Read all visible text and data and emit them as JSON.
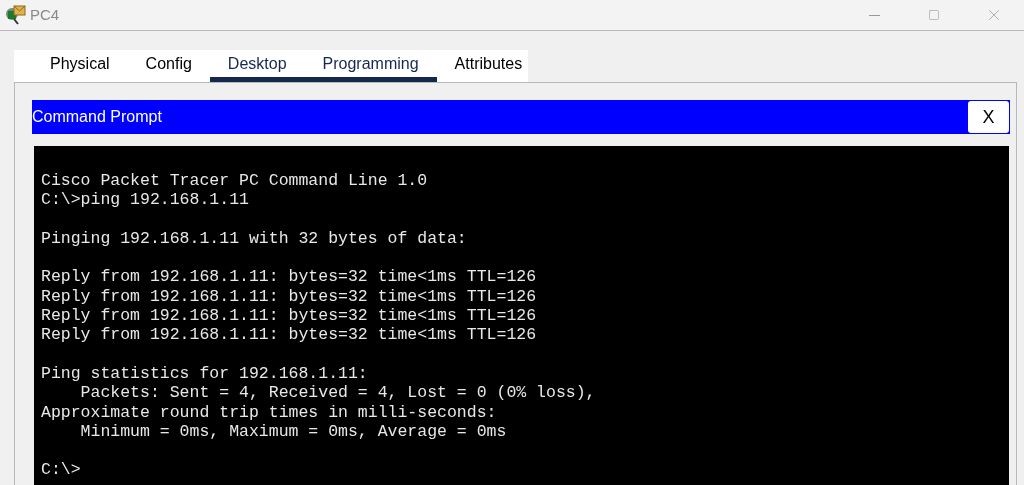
{
  "window": {
    "title": "PC4"
  },
  "tabs": [
    {
      "label": "Physical",
      "selected": false
    },
    {
      "label": "Config",
      "selected": false
    },
    {
      "label": "Desktop",
      "selected": true
    },
    {
      "label": "Programming",
      "selected": true
    },
    {
      "label": "Attributes",
      "selected": false
    }
  ],
  "command_prompt": {
    "title": "Command Prompt",
    "close_label": "X",
    "blocks": [
      [
        "Cisco Packet Tracer PC Command Line 1.0",
        "C:\\>ping 192.168.1.11"
      ],
      [
        "Pinging 192.168.1.11 with 32 bytes of data:"
      ],
      [
        "Reply from 192.168.1.11: bytes=32 time<1ms TTL=126",
        "Reply from 192.168.1.11: bytes=32 time<1ms TTL=126",
        "Reply from 192.168.1.11: bytes=32 time<1ms TTL=126",
        "Reply from 192.168.1.11: bytes=32 time<1ms TTL=126"
      ],
      [
        "Ping statistics for 192.168.1.11:",
        "    Packets: Sent = 4, Received = 4, Lost = 0 (0% loss),",
        "Approximate round trip times in milli-seconds:",
        "    Minimum = 0ms, Maximum = 0ms, Average = 0ms"
      ],
      [
        "C:\\>"
      ]
    ]
  }
}
